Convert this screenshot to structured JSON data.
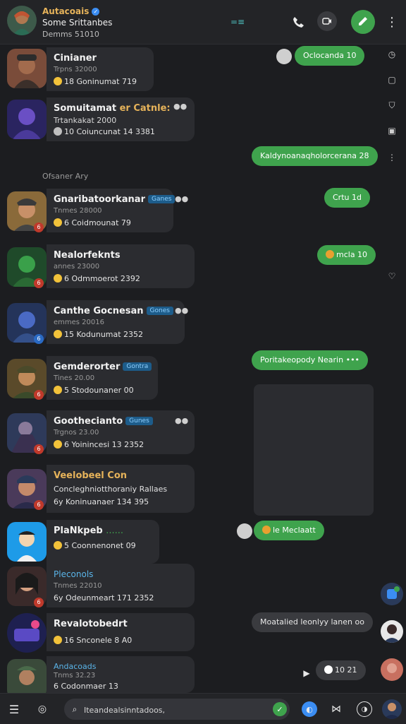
{
  "header": {
    "title": "Autacoais",
    "subtitle": "Some Srittanbes",
    "members": "Demms 51010",
    "center_icon": "=≡"
  },
  "messages": [
    {
      "name": "Cinianer",
      "tag": "",
      "ts": "Trpns 32000",
      "meta": "18  Goninumat  719",
      "badge": ""
    },
    {
      "name": "Somuitamat",
      "name2": "er Catnle:",
      "line2": "Trtankakat 2000",
      "tag": "",
      "ts": "",
      "meta": "10  Coiuncunat  14  3381",
      "badge": ""
    },
    {
      "name": "Gnaribatoorkanar",
      "tag": "Ganes",
      "ts": "Tnmes 28000",
      "meta": "6  Coidmounat  79",
      "badge": "6"
    },
    {
      "name": "Nealorfeknts",
      "tag": "",
      "ts": "annes 23000",
      "meta": "6  Odmmoerot  2392",
      "badge": "6"
    },
    {
      "name": "Canthe Gocnesan",
      "tag": "Gones",
      "ts": "emmes 20016",
      "meta": "15  Kodunumat  2352",
      "badge": "6"
    },
    {
      "name": "Gemderorter",
      "tag": "Gontra",
      "ts": "Tines 20.00",
      "meta": "5  Stodounaner  00",
      "badge": "6"
    },
    {
      "name": "Goothecianto",
      "tag": "Gunes",
      "ts": "Trgnos 23.00",
      "meta": "6  Yoinincesi  13  2352",
      "badge": "6"
    },
    {
      "name": "Veelobeel Con",
      "tag": "",
      "ts": "",
      "line2": "Concleghniotthoraniy Rallaes",
      "meta": "6y  Koninuanaer  134  395",
      "badge": "6"
    },
    {
      "name": "PlaNkpeb",
      "tag": "",
      "ts": "",
      "meta": "5  Coonnenonet  09",
      "badge": ""
    },
    {
      "name": "Pleconols",
      "tag": "",
      "ts": "Tnmes 22010",
      "meta": "6y  Odeunmeart  171  2352",
      "badge": "6"
    },
    {
      "name": "Revalotobedrt",
      "tag": "",
      "ts": "",
      "meta": "16  Snconele  8  A0",
      "badge": ""
    },
    {
      "name": "Andacoads",
      "tag": "",
      "ts": "Tnms 32.23",
      "meta": "6  Codonmaer  13",
      "badge": ""
    }
  ],
  "date_separator": "Ofsaner Ary",
  "outgoing": [
    {
      "text": "Oclocanda  10"
    },
    {
      "text": "Kaldynoanaqholorcerana  28"
    },
    {
      "text": "Crtu  1d"
    },
    {
      "text": "mcla  10"
    },
    {
      "text": "Poritakeopody Nearin"
    },
    {
      "text": "le Meclaatt"
    },
    {
      "text": "Moatalied leonlyy lanen  oo"
    },
    {
      "text": "10  21"
    }
  ],
  "search": {
    "placeholder": "Iteandealsinntadoos,"
  },
  "colors": {
    "accent_green": "#3fa34d",
    "bg": "#1c1d20",
    "card": "#2b2c30",
    "title_gold": "#e6b35a"
  }
}
